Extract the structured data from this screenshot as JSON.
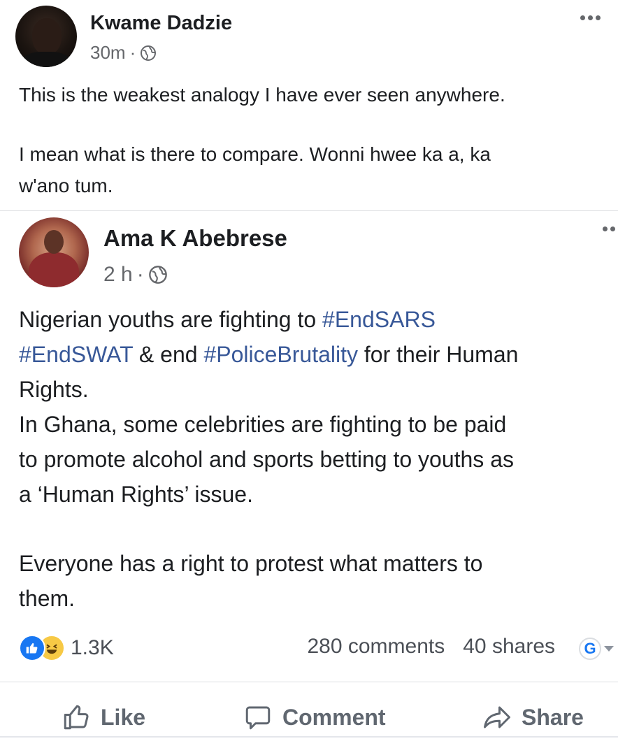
{
  "outer_post": {
    "author": "Kwame Dadzie",
    "time": "30m",
    "separator": "·",
    "privacy_icon": "globe-icon",
    "menu_icon": "more-horizontal-icon",
    "text_lines": [
      "This is the weakest analogy I have ever seen anywhere.",
      "I mean what is there to compare. Wonni hwee ka a, ka",
      "w'ano tum."
    ]
  },
  "shared_post": {
    "author": "Ama K Abebrese",
    "time": "2 h",
    "separator": "·",
    "privacy_icon": "globe-icon",
    "menu_icon": "more-horizontal-icon",
    "line1_text": "Nigerian youths are fighting to ",
    "tag_endsars": "#EndSARS",
    "tag_endswat": "#EndSWAT",
    "line2_mid": " & end ",
    "tag_policebrutality": "#PoliceBrutality",
    "line2_end": " for their Human",
    "line3": "Rights.",
    "line4": "In Ghana, some celebrities are fighting to be paid",
    "line5": "to promote alcohol and sports betting to youths as",
    "line6": "a ‘Human Rights’ issue.",
    "line7": "Everyone has a right to protest what matters to",
    "line8": "them.",
    "hashtag_color": "#385898"
  },
  "stats": {
    "reactions": [
      "like",
      "haha"
    ],
    "reaction_count": "1.3K",
    "comments": "280 comments",
    "shares": "40 shares",
    "audience_letter": "G"
  },
  "actions": {
    "like": "Like",
    "comment": "Comment",
    "share": "Share"
  },
  "colors": {
    "brand_blue": "#1877f2",
    "text_secondary": "#65676b",
    "action_gray": "#606770"
  }
}
